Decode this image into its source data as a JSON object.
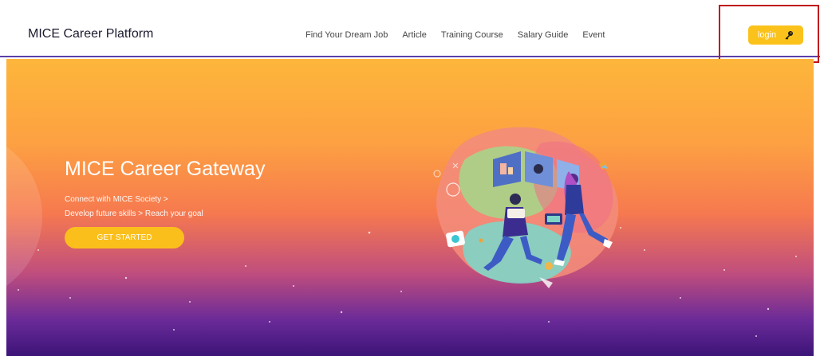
{
  "header": {
    "brand": "MICE Career Platform",
    "nav": [
      "Find Your Dream Job",
      "Article",
      "Training Course",
      "Salary Guide",
      "Event"
    ],
    "login_label": "login",
    "login_icon": "key-icon"
  },
  "hero": {
    "title": "MICE Career Gateway",
    "subtitle_line1": "Connect with MICE Society >",
    "subtitle_line2": "Develop future skills > Reach your goal",
    "cta_label": "GET STARTED"
  },
  "colors": {
    "accent": "#fbc21b",
    "nav_border": "#5b3fa8",
    "highlight": "#c0161b"
  }
}
